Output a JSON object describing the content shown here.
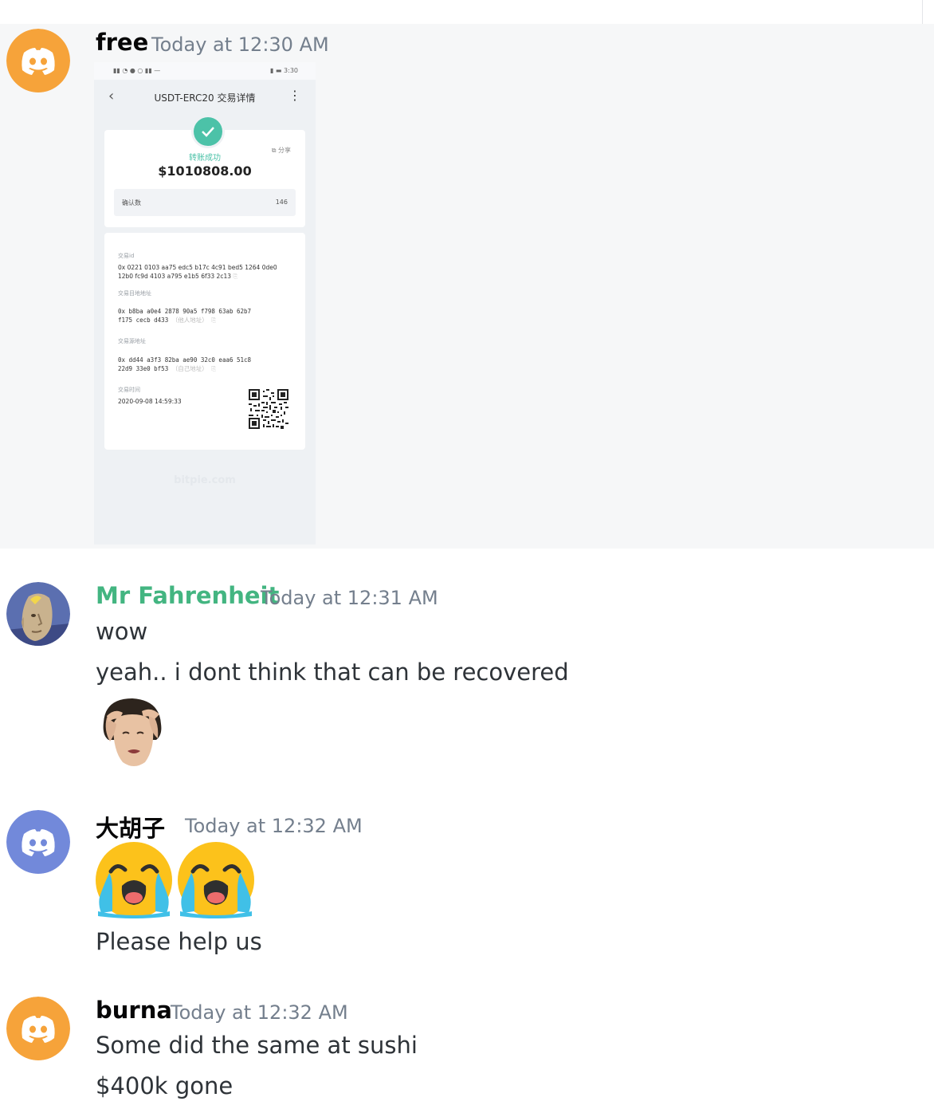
{
  "messages": [
    {
      "username": "free",
      "timestamp": "Today at 12:30 AM",
      "attachment": {
        "status_time": "3:30",
        "title": "USDT-ERC20 交易详情",
        "status": "转账成功",
        "share": "分享",
        "amount": "1010808.00",
        "confirm_label": "确认数",
        "confirm_value": "146",
        "txid_label": "交易id",
        "txid_line1": "0x 0221 0103 aa75 edc5 b17c 4c91 bed5 1264 0de0",
        "txid_line2": "12b0 fc9d 4103 a795 e1b5 6f33 2c13",
        "to_label": "交易目地地址",
        "to_line1": "0x b8ba a0e4 2878 90a5 f798 63ab 62b7",
        "to_line2": "f175 cecb d433",
        "to_note": "（他人地址）",
        "from_label": "交易源地址",
        "from_line1": "0x dd44 a3f3 82ba ae90 32c0 eaa6 51c8",
        "from_line2": "22d9 33e0 bf53",
        "from_note": "（自己地址）",
        "time_label": "交易时间",
        "time_value": "2020-09-08 14:59:33",
        "watermark": "bitpie.com"
      }
    },
    {
      "username": "Mr Fahrenheit",
      "username_color": "#43b581",
      "timestamp": "Today at 12:31 AM",
      "lines": [
        "wow",
        "yeah.. i dont think that can be recovered"
      ]
    },
    {
      "username": "大胡子",
      "timestamp": "Today at 12:32 AM",
      "emoji": [
        "loudly-crying-face",
        "loudly-crying-face"
      ],
      "lines": [
        "Please help us"
      ]
    },
    {
      "username": "burna",
      "timestamp": "Today at 12:32 AM",
      "lines": [
        "Some did the same at sushi",
        "$400k gone"
      ]
    }
  ],
  "colors": {
    "avatar_orange": "#f6a33a",
    "avatar_blurple": "#7289da",
    "mention_green": "#43b581",
    "success_teal": "#4cc2a8"
  }
}
